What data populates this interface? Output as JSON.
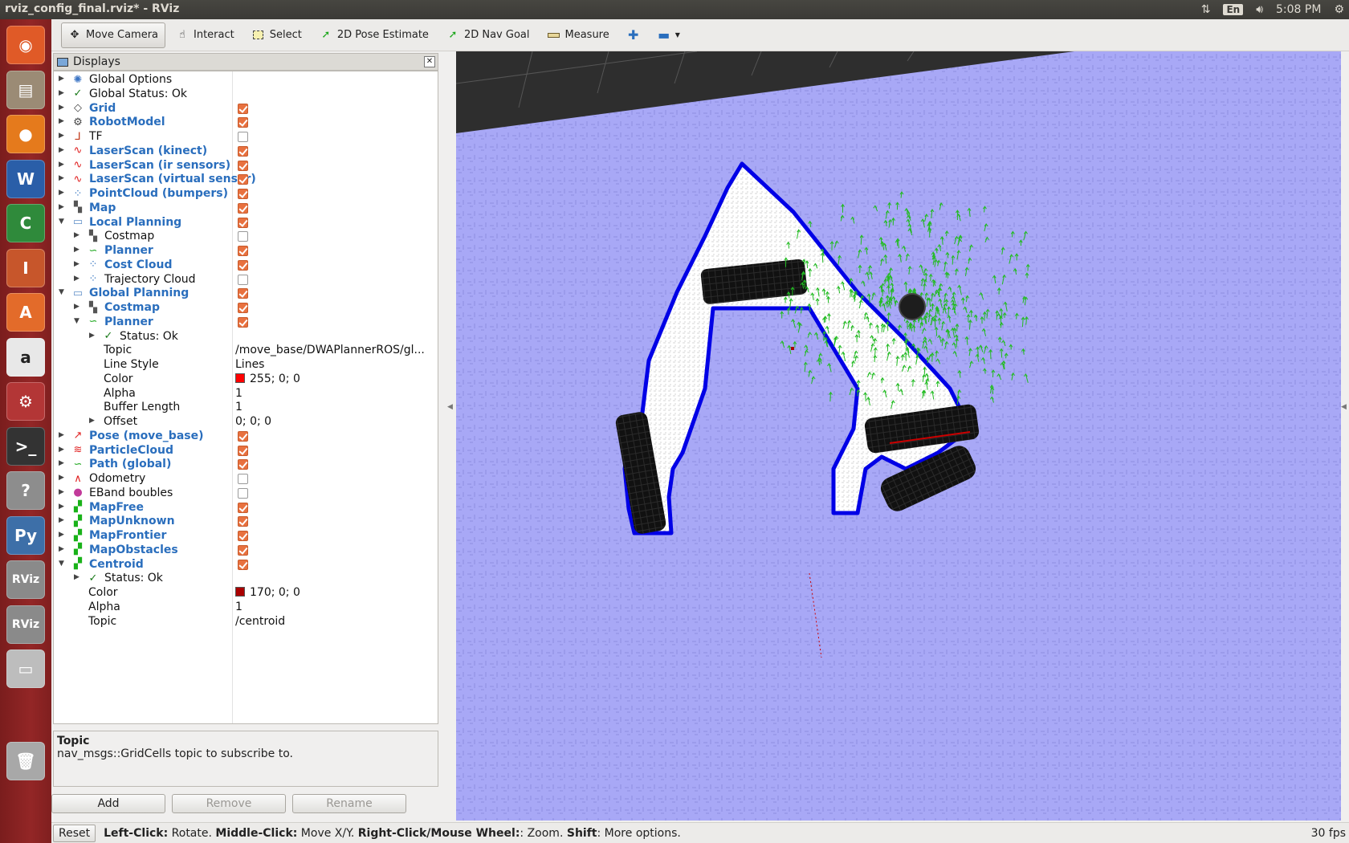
{
  "window": {
    "title": "rviz_config_final.rviz* - RViz"
  },
  "tray": {
    "lang": "En",
    "time": "5:08 PM"
  },
  "launcher": [
    {
      "name": "ubuntu-home-icon",
      "glyph": "◉",
      "bg": "#e05a27"
    },
    {
      "name": "files-icon",
      "glyph": "▤",
      "bg": "#9b8b75"
    },
    {
      "name": "firefox-icon",
      "glyph": "●",
      "bg": "#e57a1c"
    },
    {
      "name": "writer-icon",
      "glyph": "W",
      "bg": "#2a5ea8"
    },
    {
      "name": "calc-icon",
      "glyph": "C",
      "bg": "#2f8a3b"
    },
    {
      "name": "impress-icon",
      "glyph": "I",
      "bg": "#c7562b"
    },
    {
      "name": "software-center-icon",
      "glyph": "A",
      "bg": "#e36b2a"
    },
    {
      "name": "amazon-icon",
      "glyph": "a",
      "bg": "#e8e8e8"
    },
    {
      "name": "system-settings-icon",
      "glyph": "⚙",
      "bg": "#b33636"
    },
    {
      "name": "terminal-icon",
      "glyph": ">_",
      "bg": "#333333"
    },
    {
      "name": "help-icon",
      "glyph": "?",
      "bg": "#8d8d8d"
    },
    {
      "name": "python-icon",
      "glyph": "Py",
      "bg": "#3d6fa8"
    },
    {
      "name": "rviz-icon",
      "glyph": "RViz",
      "bg": "#8a8a8a"
    },
    {
      "name": "rviz-icon-2",
      "glyph": "RViz",
      "bg": "#8a8a8a"
    },
    {
      "name": "drive-icon",
      "glyph": "▭",
      "bg": "#bdbdbd"
    },
    {
      "name": "trash-icon",
      "glyph": "🗑",
      "bg": "#a8a8a8"
    }
  ],
  "toolbar": {
    "move_camera": "Move Camera",
    "interact": "Interact",
    "select": "Select",
    "pose_estimate": "2D Pose Estimate",
    "nav_goal": "2D Nav Goal",
    "measure": "Measure"
  },
  "panel": {
    "title": "Displays",
    "tree": [
      {
        "indent": 0,
        "arrow": "right",
        "icon": "globe",
        "label": "Global Options",
        "style": "black"
      },
      {
        "indent": 0,
        "arrow": "right",
        "icon": "check",
        "label": "Global Status: Ok",
        "style": "black"
      },
      {
        "indent": 0,
        "arrow": "right",
        "icon": "grid",
        "label": "Grid",
        "style": "blue",
        "checked": true
      },
      {
        "indent": 0,
        "arrow": "right",
        "icon": "robot",
        "label": "RobotModel",
        "style": "blue",
        "checked": true
      },
      {
        "indent": 0,
        "arrow": "right",
        "icon": "tf",
        "label": "TF",
        "style": "black",
        "checked": false
      },
      {
        "indent": 0,
        "arrow": "right",
        "icon": "laser",
        "label": "LaserScan (kinect)",
        "style": "blue",
        "checked": true
      },
      {
        "indent": 0,
        "arrow": "right",
        "icon": "laser",
        "label": "LaserScan (ir sensors)",
        "style": "blue",
        "checked": true
      },
      {
        "indent": 0,
        "arrow": "right",
        "icon": "laser",
        "label": "LaserScan (virtual sensor)",
        "style": "blue",
        "checked": true
      },
      {
        "indent": 0,
        "arrow": "right",
        "icon": "cloud",
        "label": "PointCloud (bumpers)",
        "style": "blue",
        "checked": true
      },
      {
        "indent": 0,
        "arrow": "right",
        "icon": "map",
        "label": "Map",
        "style": "blue",
        "checked": true
      },
      {
        "indent": 0,
        "arrow": "down",
        "icon": "folder",
        "label": "Local Planning",
        "style": "blue",
        "checked": true
      },
      {
        "indent": 1,
        "arrow": "right",
        "icon": "map",
        "label": "Costmap",
        "style": "black",
        "checked": false
      },
      {
        "indent": 1,
        "arrow": "right",
        "icon": "path",
        "label": "Planner",
        "style": "blue",
        "checked": true
      },
      {
        "indent": 1,
        "arrow": "right",
        "icon": "cloud",
        "label": "Cost Cloud",
        "style": "blue",
        "checked": true
      },
      {
        "indent": 1,
        "arrow": "right",
        "icon": "cloud",
        "label": "Trajectory Cloud",
        "style": "black",
        "checked": false
      },
      {
        "indent": 0,
        "arrow": "down",
        "icon": "folder",
        "label": "Global Planning",
        "style": "blue",
        "checked": true
      },
      {
        "indent": 1,
        "arrow": "right",
        "icon": "map",
        "label": "Costmap",
        "style": "blue",
        "checked": true
      },
      {
        "indent": 1,
        "arrow": "down",
        "icon": "path",
        "label": "Planner",
        "style": "blue",
        "checked": true
      },
      {
        "indent": 2,
        "arrow": "right",
        "icon": "check",
        "label": "Status: Ok",
        "style": "black"
      },
      {
        "indent": 2,
        "arrow": "none",
        "icon": "none",
        "label": "Topic",
        "style": "black",
        "value": "/move_base/DWAPlannerROS/gl..."
      },
      {
        "indent": 2,
        "arrow": "none",
        "icon": "none",
        "label": "Line Style",
        "style": "black",
        "value": "Lines"
      },
      {
        "indent": 2,
        "arrow": "none",
        "icon": "none",
        "label": "Color",
        "style": "black",
        "value": "255; 0; 0",
        "swatch": "#ff0000"
      },
      {
        "indent": 2,
        "arrow": "none",
        "icon": "none",
        "label": "Alpha",
        "style": "black",
        "value": "1"
      },
      {
        "indent": 2,
        "arrow": "none",
        "icon": "none",
        "label": "Buffer Length",
        "style": "black",
        "value": "1"
      },
      {
        "indent": 2,
        "arrow": "right",
        "icon": "none",
        "label": "Offset",
        "style": "black",
        "value": "0; 0; 0"
      },
      {
        "indent": 0,
        "arrow": "right",
        "icon": "pose",
        "label": "Pose (move_base)",
        "style": "blue",
        "checked": true
      },
      {
        "indent": 0,
        "arrow": "right",
        "icon": "particles",
        "label": "ParticleCloud",
        "style": "blue",
        "checked": true
      },
      {
        "indent": 0,
        "arrow": "right",
        "icon": "path",
        "label": "Path (global)",
        "style": "blue",
        "checked": true
      },
      {
        "indent": 0,
        "arrow": "right",
        "icon": "odom",
        "label": "Odometry",
        "style": "black",
        "checked": false
      },
      {
        "indent": 0,
        "arrow": "right",
        "icon": "bubbles",
        "label": "EBand boubles",
        "style": "black",
        "checked": false
      },
      {
        "indent": 0,
        "arrow": "right",
        "icon": "gridcells",
        "label": "MapFree",
        "style": "blue",
        "checked": true
      },
      {
        "indent": 0,
        "arrow": "right",
        "icon": "gridcells",
        "label": "MapUnknown",
        "style": "blue",
        "checked": true
      },
      {
        "indent": 0,
        "arrow": "right",
        "icon": "gridcells",
        "label": "MapFrontier",
        "style": "blue",
        "checked": true
      },
      {
        "indent": 0,
        "arrow": "right",
        "icon": "gridcells",
        "label": "MapObstacles",
        "style": "blue",
        "checked": true
      },
      {
        "indent": 0,
        "arrow": "down",
        "icon": "gridcells",
        "label": "Centroid",
        "style": "blue",
        "checked": true
      },
      {
        "indent": 1,
        "arrow": "right",
        "icon": "check",
        "label": "Status: Ok",
        "style": "black"
      },
      {
        "indent": 1,
        "arrow": "none",
        "icon": "none",
        "label": "Color",
        "style": "black",
        "value": "170; 0; 0",
        "swatch": "#aa0000"
      },
      {
        "indent": 1,
        "arrow": "none",
        "icon": "none",
        "label": "Alpha",
        "style": "black",
        "value": "1"
      },
      {
        "indent": 1,
        "arrow": "none",
        "icon": "none",
        "label": "Topic",
        "style": "black",
        "value": "/centroid"
      }
    ],
    "desc_title": "Topic",
    "desc_text": "nav_msgs::GridCells topic to subscribe to.",
    "add": "Add",
    "remove": "Remove",
    "rename": "Rename"
  },
  "statusbar": {
    "reset": "Reset",
    "k1": "Left-Click:",
    "v1": " Rotate. ",
    "k2": "Middle-Click:",
    "v2": " Move X/Y. ",
    "k3": "Right-Click/Mouse Wheel:",
    "v3": ": Zoom. ",
    "k4": "Shift",
    "v4": ": More options.",
    "fps": "30 fps"
  },
  "colors": {
    "floor": "#a8a8f6",
    "free": "#ffffff",
    "frontier": "#0000e6",
    "obstacle": "#111111",
    "trajectory": "#22bb22",
    "unknown_dark": "#2e2e2e"
  }
}
